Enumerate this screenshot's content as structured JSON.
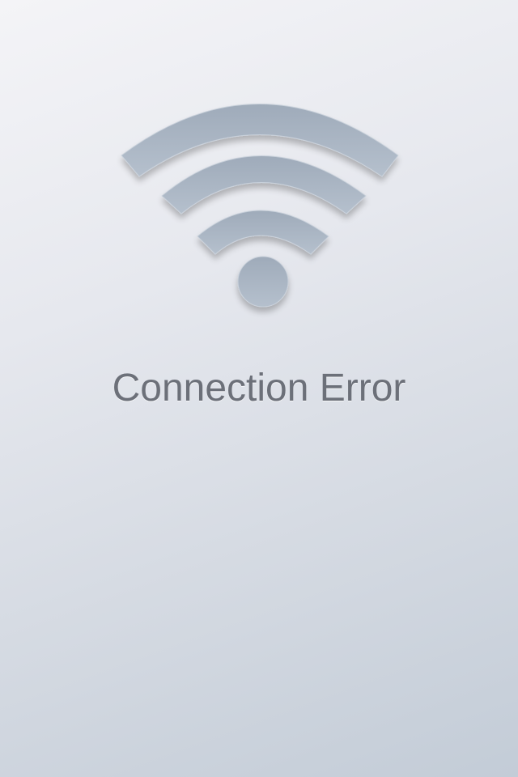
{
  "screen": {
    "title": "Connection Error",
    "icon": "wifi-icon"
  },
  "colors": {
    "icon_fill": "#a8b3c2",
    "text": "#6c7079"
  }
}
